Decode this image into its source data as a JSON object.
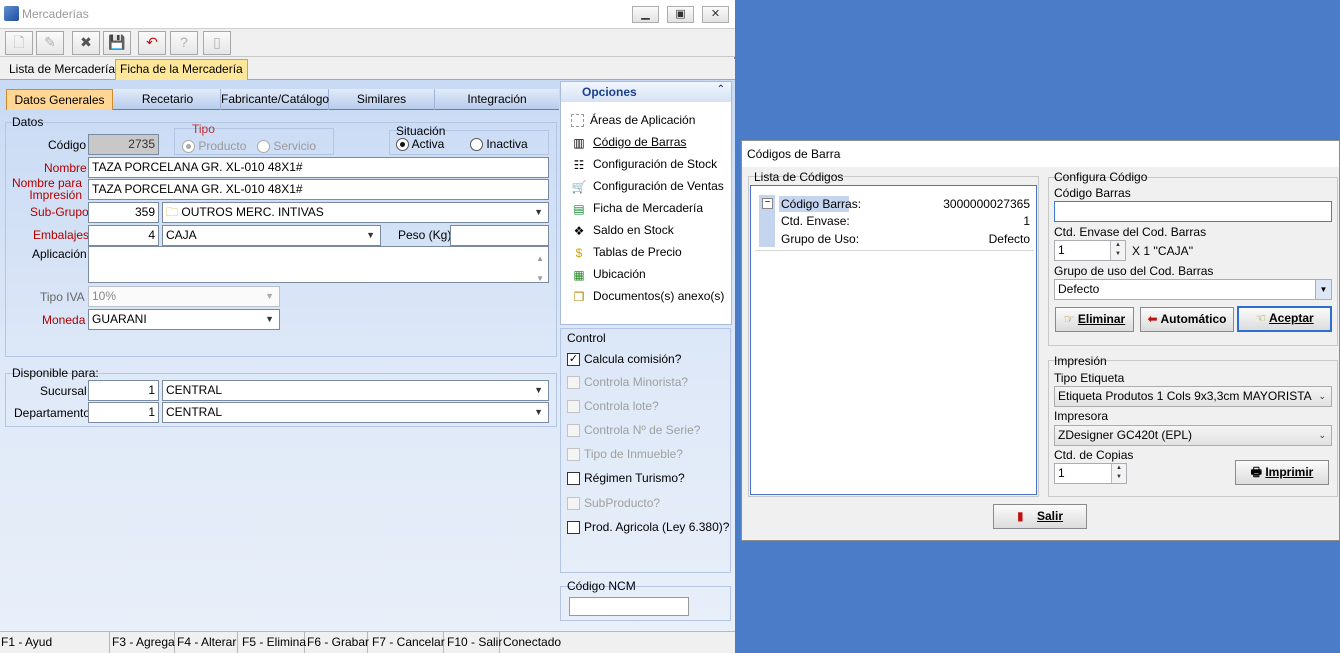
{
  "main": {
    "title": "Mercaderías",
    "top_tabs": [
      "Lista de Mercaderías",
      "Ficha de la Mercadería"
    ],
    "sub_tabs": [
      "Datos Generales",
      "Recetario",
      "Fabricante/Catálogo",
      "Similares",
      "Integración"
    ],
    "datos": {
      "section": "Datos",
      "codigo_label": "Código",
      "codigo": "2735",
      "tipo_label": "Tipo",
      "tipo_producto": "Producto",
      "tipo_servicio": "Servicio",
      "situacion_label": "Situación",
      "activa": "Activa",
      "inactiva": "Inactiva",
      "nombre_label": "Nombre",
      "nombre": "TAZA PORCELANA GR. XL-010 48X1#",
      "nombre_impresion_label": "Nombre para Impresión",
      "nombre_impresion": "TAZA PORCELANA GR. XL-010 48X1#",
      "subgrupo_label": "Sub-Grupo",
      "subgrupo_code": "359",
      "subgrupo": "OUTROS MERC. INTIVAS",
      "embalajes_label": "Embalajes",
      "embalajes_code": "4",
      "embalaje": "CAJA",
      "peso_label": "Peso (Kg)",
      "peso": "",
      "aplicacion_label": "Aplicación",
      "tipo_iva_label": "Tipo IVA",
      "tipo_iva": "10%",
      "moneda_label": "Moneda",
      "moneda": "GUARANI"
    },
    "disponible": {
      "section": "Disponible para:",
      "sucursal_label": "Sucursal",
      "sucursal_code": "1",
      "sucursal": "CENTRAL",
      "departamento_label": "Departamento",
      "departamento_code": "1",
      "departamento": "CENTRAL"
    },
    "opciones": {
      "title": "Opciones",
      "items": [
        "Áreas de Aplicación",
        "Código de Barras",
        "Configuración de Stock",
        "Configuración de Ventas",
        "Ficha de Mercadería",
        "Saldo en Stock",
        "Tablas de Precio",
        "Ubicación",
        "Documentos(s) anexo(s)"
      ]
    },
    "control": {
      "title": "Control",
      "items": [
        {
          "label": "Calcula comisión?",
          "checked": true,
          "enabled": true
        },
        {
          "label": "Controla Minorista?",
          "checked": false,
          "enabled": false
        },
        {
          "label": "Controla lote?",
          "checked": false,
          "enabled": false
        },
        {
          "label": "Controla Nº de Serie?",
          "checked": false,
          "enabled": false
        },
        {
          "label": "Tipo de Inmueble?",
          "checked": false,
          "enabled": false
        },
        {
          "label": "Régimen Turismo?",
          "checked": false,
          "enabled": true
        },
        {
          "label": "SubProducto?",
          "checked": false,
          "enabled": false
        },
        {
          "label": "Prod. Agricola (Ley 6.380)?",
          "checked": false,
          "enabled": true
        }
      ]
    },
    "ncm_label": "Código NCM",
    "status": [
      "F1 - Ayud",
      "F3 - Agrega",
      "F4 - Alterar",
      "F5 - Elimina",
      "F6 - Grabar",
      "F7 - Cancelar",
      "F10 - Salir",
      "Conectado"
    ]
  },
  "dialog": {
    "title": "Códigos de Barra",
    "lista_label": "Lista de Códigos",
    "tree": [
      {
        "key": "Código Barras:",
        "value": "3000000027365"
      },
      {
        "key": "Ctd. Envase:",
        "value": "1"
      },
      {
        "key": "Grupo de Uso:",
        "value": "Defecto"
      }
    ],
    "config_label": "Configura Código",
    "codigo_barras_label": "Código Barras",
    "codigo_barras_value": "",
    "ctd_envase_label": "Ctd. Envase del Cod. Barras",
    "ctd_envase": "1",
    "ctd_envase_suffix": "X 1 ''CAJA''",
    "grupo_label": "Grupo de uso del Cod. Barras",
    "grupo": "Defecto",
    "btn_eliminar": "Eliminar",
    "btn_automatico": "Automático",
    "btn_aceptar": "Aceptar",
    "impresion_label": "Impresión",
    "tipo_etiqueta_label": "Tipo Etiqueta",
    "tipo_etiqueta": "Etiqueta Produtos 1 Cols 9x3,3cm MAYORISTA",
    "impresora_label": "Impresora",
    "impresora": "ZDesigner GC420t (EPL)",
    "copias_label": "Ctd. de Copias",
    "copias": "1",
    "btn_imprimir": "Imprimir",
    "btn_salir": "Salir"
  }
}
